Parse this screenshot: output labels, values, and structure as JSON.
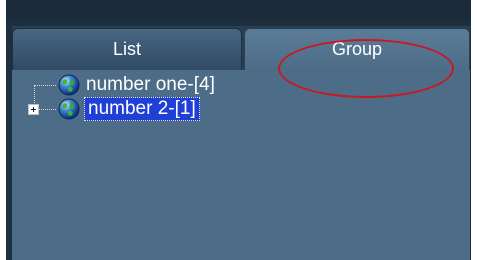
{
  "tabs": [
    {
      "label": "List",
      "active": false
    },
    {
      "label": "Group",
      "active": true
    }
  ],
  "tree": {
    "items": [
      {
        "label": "number one-[4]",
        "icon": "globe-icon",
        "expandable": false,
        "selected": false
      },
      {
        "label": "number 2-[1]",
        "icon": "globe-icon",
        "expandable": true,
        "selected": true
      }
    ]
  },
  "annotation": {
    "ellipse_color": "#c8191f"
  },
  "colors": {
    "panel_background": "#4d6c88",
    "selection_background": "#1f3fd6",
    "frame_dark": "#1e2f3f"
  }
}
